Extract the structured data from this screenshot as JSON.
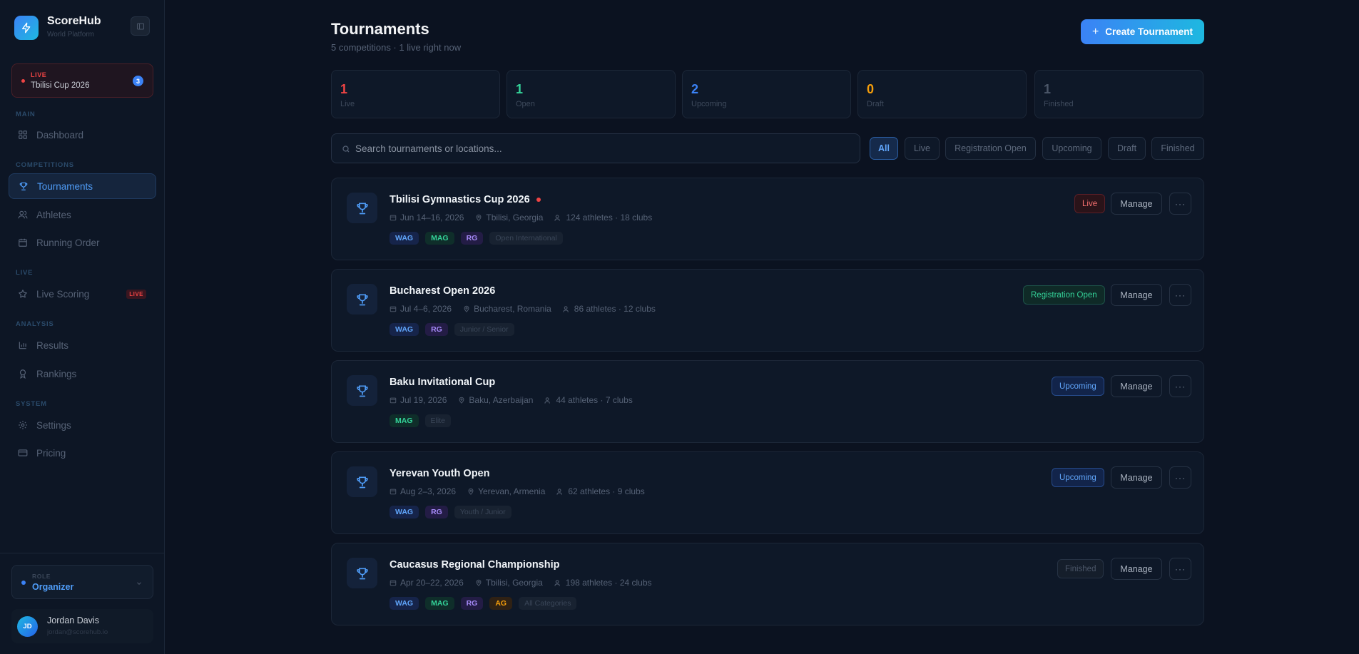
{
  "brand": {
    "name": "ScoreHub",
    "subtitle": "World Platform"
  },
  "sidebar": {
    "live_card": {
      "label": "LIVE",
      "name": "Tbilisi Cup 2026",
      "count": "3"
    },
    "sections": {
      "main": "MAIN",
      "competitions": "COMPETITIONS",
      "live": "LIVE",
      "analysis": "ANALYSIS",
      "system": "SYSTEM"
    },
    "items": [
      {
        "label": "Dashboard"
      },
      {
        "label": "Tournaments"
      },
      {
        "label": "Athletes"
      },
      {
        "label": "Running Order"
      },
      {
        "label": "Live Scoring",
        "tag": "LIVE"
      },
      {
        "label": "Results"
      },
      {
        "label": "Rankings"
      },
      {
        "label": "Settings"
      },
      {
        "label": "Pricing"
      }
    ],
    "role": {
      "label": "ROLE",
      "value": "Organizer"
    },
    "user": {
      "initials": "JD",
      "name": "Jordan Davis",
      "email": "jordan@scorehub.io"
    }
  },
  "header": {
    "title": "Tournaments",
    "subtitle": "5 competitions · 1 live right now",
    "create_label": "Create Tournament"
  },
  "stats": [
    {
      "value": "1",
      "label": "Live",
      "color": "#ef4444"
    },
    {
      "value": "1",
      "label": "Open",
      "color": "#34d399"
    },
    {
      "value": "2",
      "label": "Upcoming",
      "color": "#3b82f6"
    },
    {
      "value": "0",
      "label": "Draft",
      "color": "#f59e0b"
    },
    {
      "value": "1",
      "label": "Finished",
      "color": "#4b5668"
    }
  ],
  "search": {
    "placeholder": "Search tournaments or locations..."
  },
  "filters": [
    "All",
    "Live",
    "Registration Open",
    "Upcoming",
    "Draft",
    "Finished"
  ],
  "tournaments": [
    {
      "title": "Tbilisi Gymnastics Cup 2026",
      "date": "Jun 14–16, 2026",
      "location": "Tbilisi, Georgia",
      "athletes": "124 athletes · 18 clubs",
      "tags": [
        "WAG",
        "MAG",
        "RG"
      ],
      "category": "Open International",
      "status": "Live"
    },
    {
      "title": "Bucharest Open 2026",
      "date": "Jul 4–6, 2026",
      "location": "Bucharest, Romania",
      "athletes": "86 athletes · 12 clubs",
      "tags": [
        "WAG",
        "RG"
      ],
      "category": "Junior / Senior",
      "status": "Registration Open"
    },
    {
      "title": "Baku Invitational Cup",
      "date": "Jul 19, 2026",
      "location": "Baku, Azerbaijan",
      "athletes": "44 athletes · 7 clubs",
      "tags": [
        "MAG"
      ],
      "category": "Elite",
      "status": "Upcoming"
    },
    {
      "title": "Yerevan Youth Open",
      "date": "Aug 2–3, 2026",
      "location": "Yerevan, Armenia",
      "athletes": "62 athletes · 9 clubs",
      "tags": [
        "WAG",
        "RG"
      ],
      "category": "Youth / Junior",
      "status": "Upcoming"
    },
    {
      "title": "Caucasus Regional Championship",
      "date": "Apr 20–22, 2026",
      "location": "Tbilisi, Georgia",
      "athletes": "198 athletes · 24 clubs",
      "tags": [
        "WAG",
        "MAG",
        "RG",
        "AG"
      ],
      "category": "All Categories",
      "status": "Finished"
    }
  ],
  "actions": {
    "manage": "Manage",
    "more": "···"
  }
}
